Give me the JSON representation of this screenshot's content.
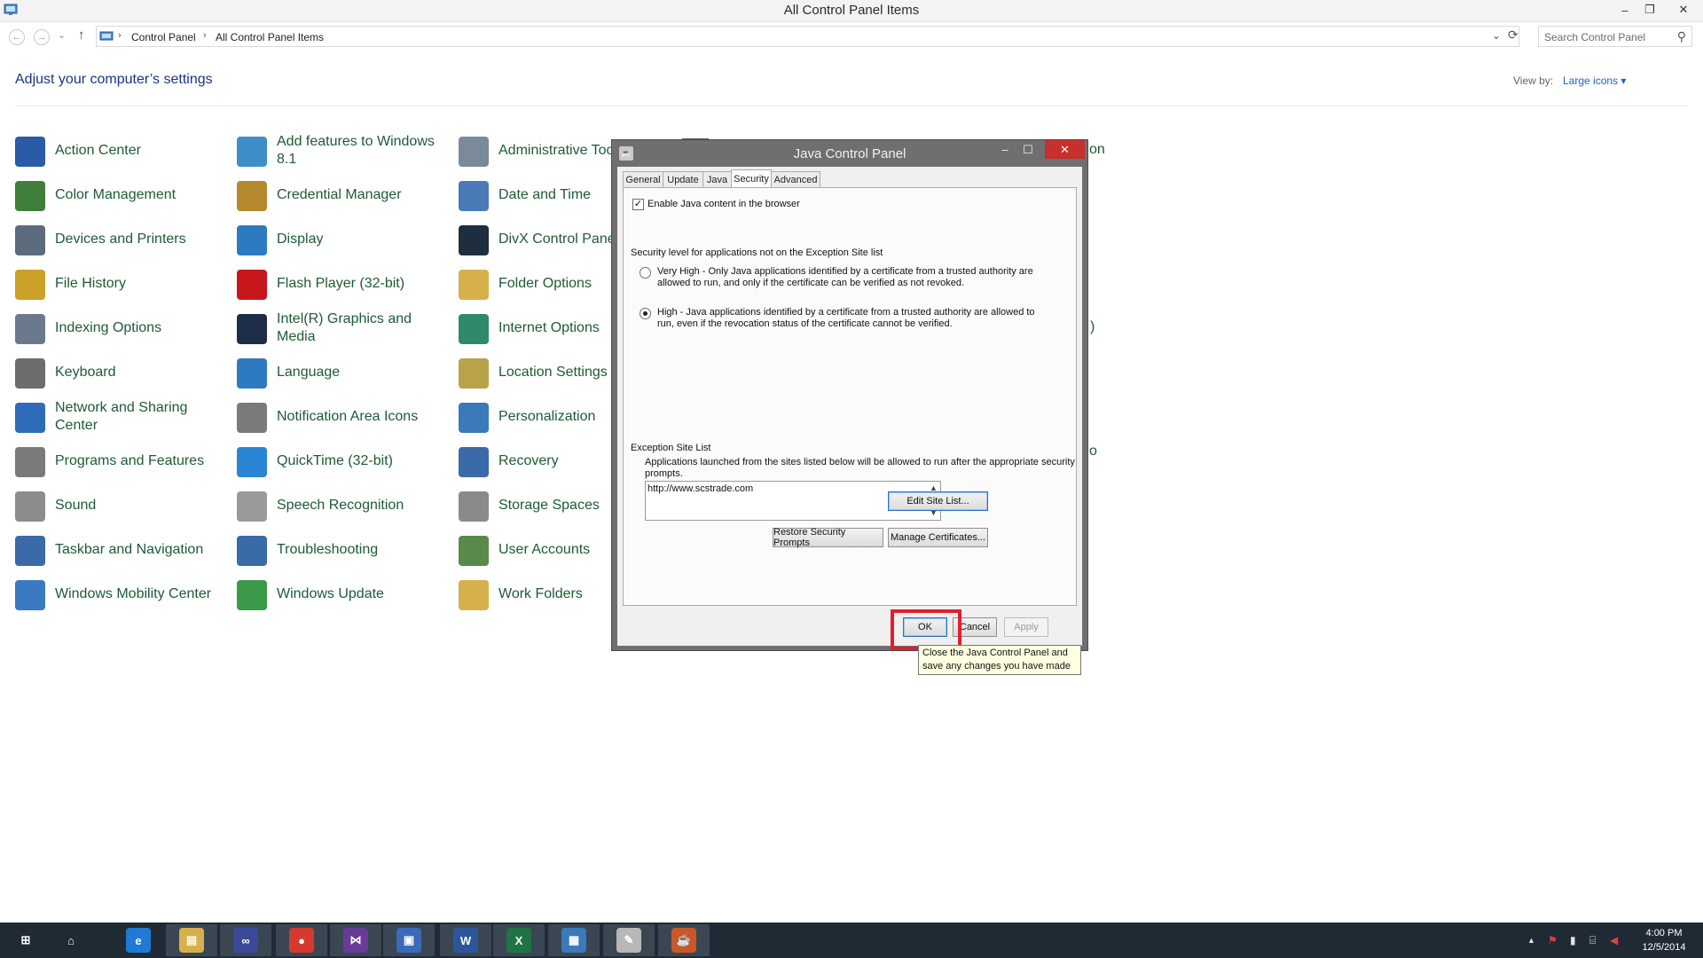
{
  "window": {
    "title": "All Control Panel Items",
    "minimize": "–",
    "restore": "❐",
    "close": "✕"
  },
  "address": {
    "back": "←",
    "forward": "→",
    "recent": "⌄",
    "up": "↑",
    "crumbs": [
      "Control Panel",
      "All Control Panel Items"
    ],
    "sep": "›",
    "dropdown": "⌄",
    "refresh": "⟳",
    "search_placeholder": "Search Control Panel",
    "search_icon": "⚲"
  },
  "header": {
    "heading": "Adjust your computer’s settings",
    "view_by_label": "View by:",
    "view_by_value": "Large icons ▾"
  },
  "items": {
    "col1": [
      {
        "label": "Action Center",
        "icon": "flag-icon",
        "color": "#2a5aa8"
      },
      {
        "label": "Color Management",
        "icon": "color-management-icon",
        "color": "#3f7f3a"
      },
      {
        "label": "Devices and Printers",
        "icon": "printer-icon",
        "color": "#5c6c7e"
      },
      {
        "label": "File History",
        "icon": "file-history-icon",
        "color": "#c9a227"
      },
      {
        "label": "Indexing Options",
        "icon": "indexing-icon",
        "color": "#6a7a8c"
      },
      {
        "label": "Keyboard",
        "icon": "keyboard-icon",
        "color": "#6d6d6d"
      },
      {
        "label": "Network and Sharing Center",
        "line1": "Network and Sharing",
        "line2": "Center",
        "icon": "network-icon",
        "color": "#2e6bb8"
      },
      {
        "label": "Programs and Features",
        "icon": "programs-icon",
        "color": "#7a7a7a"
      },
      {
        "label": "Sound",
        "icon": "speaker-icon",
        "color": "#8c8c8c"
      },
      {
        "label": "Taskbar and Navigation",
        "icon": "taskbar-icon",
        "color": "#3a6aa8"
      },
      {
        "label": "Windows Mobility Center",
        "icon": "mobility-icon",
        "color": "#3a7ac0"
      }
    ],
    "col2": [
      {
        "label": "Add features to Windows 8.1",
        "line1": "Add features to Windows",
        "line2": "8.1",
        "icon": "add-features-icon",
        "color": "#3e8fc8"
      },
      {
        "label": "Credential Manager",
        "icon": "credential-icon",
        "color": "#b58a2e"
      },
      {
        "label": "Display",
        "icon": "display-icon",
        "color": "#2e7ac0"
      },
      {
        "label": "Flash Player (32-bit)",
        "icon": "flash-icon",
        "color": "#c8161d"
      },
      {
        "label": "Intel(R) Graphics and Media",
        "line1": "Intel(R) Graphics and",
        "line2": "Media",
        "icon": "intel-graphics-icon",
        "color": "#1e2e48"
      },
      {
        "label": "Language",
        "icon": "language-icon",
        "color": "#2e7ac0"
      },
      {
        "label": "Notification Area Icons",
        "icon": "notification-icon",
        "color": "#7a7a7a"
      },
      {
        "label": "QuickTime (32-bit)",
        "icon": "quicktime-icon",
        "color": "#2a86d4"
      },
      {
        "label": "Speech Recognition",
        "icon": "microphone-icon",
        "color": "#9a9a9a"
      },
      {
        "label": "Troubleshooting",
        "icon": "troubleshooting-icon",
        "color": "#3a6aa8"
      },
      {
        "label": "Windows Update",
        "icon": "windows-update-icon",
        "color": "#3a9a4a"
      }
    ],
    "col3": [
      {
        "label": "Administrative Tools",
        "visible": "Administrative Too",
        "icon": "admin-tools-icon",
        "color": "#7a8a9a"
      },
      {
        "label": "Date and Time",
        "icon": "calendar-icon",
        "color": "#4a7ab8"
      },
      {
        "label": "DivX Control Panel",
        "visible": "DivX Control Pane",
        "icon": "divx-icon",
        "color": "#1e2e3e"
      },
      {
        "label": "Folder Options",
        "icon": "folder-icon",
        "color": "#d6b04a"
      },
      {
        "label": "Internet Options",
        "icon": "globe-icon",
        "color": "#2e8a6a"
      },
      {
        "label": "Location Settings",
        "icon": "location-icon",
        "color": "#b8a24a"
      },
      {
        "label": "Personalization",
        "icon": "personalization-icon",
        "color": "#3a7ab8"
      },
      {
        "label": "Recovery",
        "icon": "recovery-icon",
        "color": "#3a6aa8"
      },
      {
        "label": "Storage Spaces",
        "icon": "storage-icon",
        "color": "#8a8a8a"
      },
      {
        "label": "User Accounts",
        "icon": "user-accounts-icon",
        "color": "#5a8a4a"
      },
      {
        "label": "Work Folders",
        "icon": "work-folders-icon",
        "color": "#d6b04a"
      }
    ]
  },
  "behind_fragments": {
    "f1": "on",
    "f2": ")",
    "f3": "o"
  },
  "dialog": {
    "title": "Java Control Panel",
    "minimize": "–",
    "maximize": "☐",
    "close": "✕",
    "tabs": [
      "General",
      "Update",
      "Java",
      "Security",
      "Advanced"
    ],
    "enable_java_label": "Enable Java content in the browser",
    "enable_java_mark": "✓",
    "security_level_heading": "Security level for applications not on the Exception Site list",
    "very_high_line1": "Very High - Only Java applications identified by a certificate from a trusted authority are",
    "very_high_line2": "allowed to run, and only if the certificate can be verified as not revoked.",
    "high_line1": "High - Java applications identified by a certificate from a trusted authority are allowed to",
    "high_line2": "run, even if the revocation status of the certificate cannot be verified.",
    "exception_heading": "Exception Site List",
    "exception_desc_line1": "Applications launched from the sites listed below will be allowed to run after the appropriate security",
    "exception_desc_line2": "prompts.",
    "site": "http://www.scstrade.com",
    "scroll_up": "▲",
    "scroll_down": "▼",
    "edit_site_list": "Edit Site List...",
    "restore_prompts": "Restore Security Prompts",
    "manage_certificates": "Manage Certificates...",
    "ok": "OK",
    "cancel": "Cancel",
    "apply": "Apply",
    "tooltip_line1": "Close the Java Control Panel and",
    "tooltip_line2": "save any changes you have made"
  },
  "taskbar": {
    "items": [
      {
        "name": "start",
        "glyph": "⊞",
        "color": "#1f2a35"
      },
      {
        "name": "home",
        "glyph": "⌂",
        "color": "#1f2a35"
      },
      {
        "name": "internet-explorer",
        "glyph": "e",
        "color": "#1e7ad4"
      },
      {
        "name": "file-explorer",
        "glyph": "▤",
        "color": "#d6b04a"
      },
      {
        "name": "infinity-app",
        "glyph": "∞",
        "color": "#3a4a9a"
      },
      {
        "name": "chrome",
        "glyph": "●",
        "color": "#d63a2e"
      },
      {
        "name": "visual-studio",
        "glyph": "⋈",
        "color": "#6a3a9a"
      },
      {
        "name": "remote-desktop",
        "glyph": "▣",
        "color": "#3a6ab8"
      },
      {
        "name": "word",
        "glyph": "W",
        "color": "#2b579a"
      },
      {
        "name": "excel",
        "glyph": "X",
        "color": "#217346"
      },
      {
        "name": "control-panel",
        "glyph": "▦",
        "color": "#3a7ab8"
      },
      {
        "name": "paint",
        "glyph": "✎",
        "color": "#b8b8b8"
      },
      {
        "name": "java",
        "glyph": "☕",
        "color": "#c8582a"
      }
    ],
    "tray_arrow": "▲",
    "tray_flag": "⚑",
    "tray_battery": "▮",
    "tray_network": "⌸",
    "tray_volume": "◀",
    "time": "4:00 PM",
    "date": "12/5/2014"
  }
}
